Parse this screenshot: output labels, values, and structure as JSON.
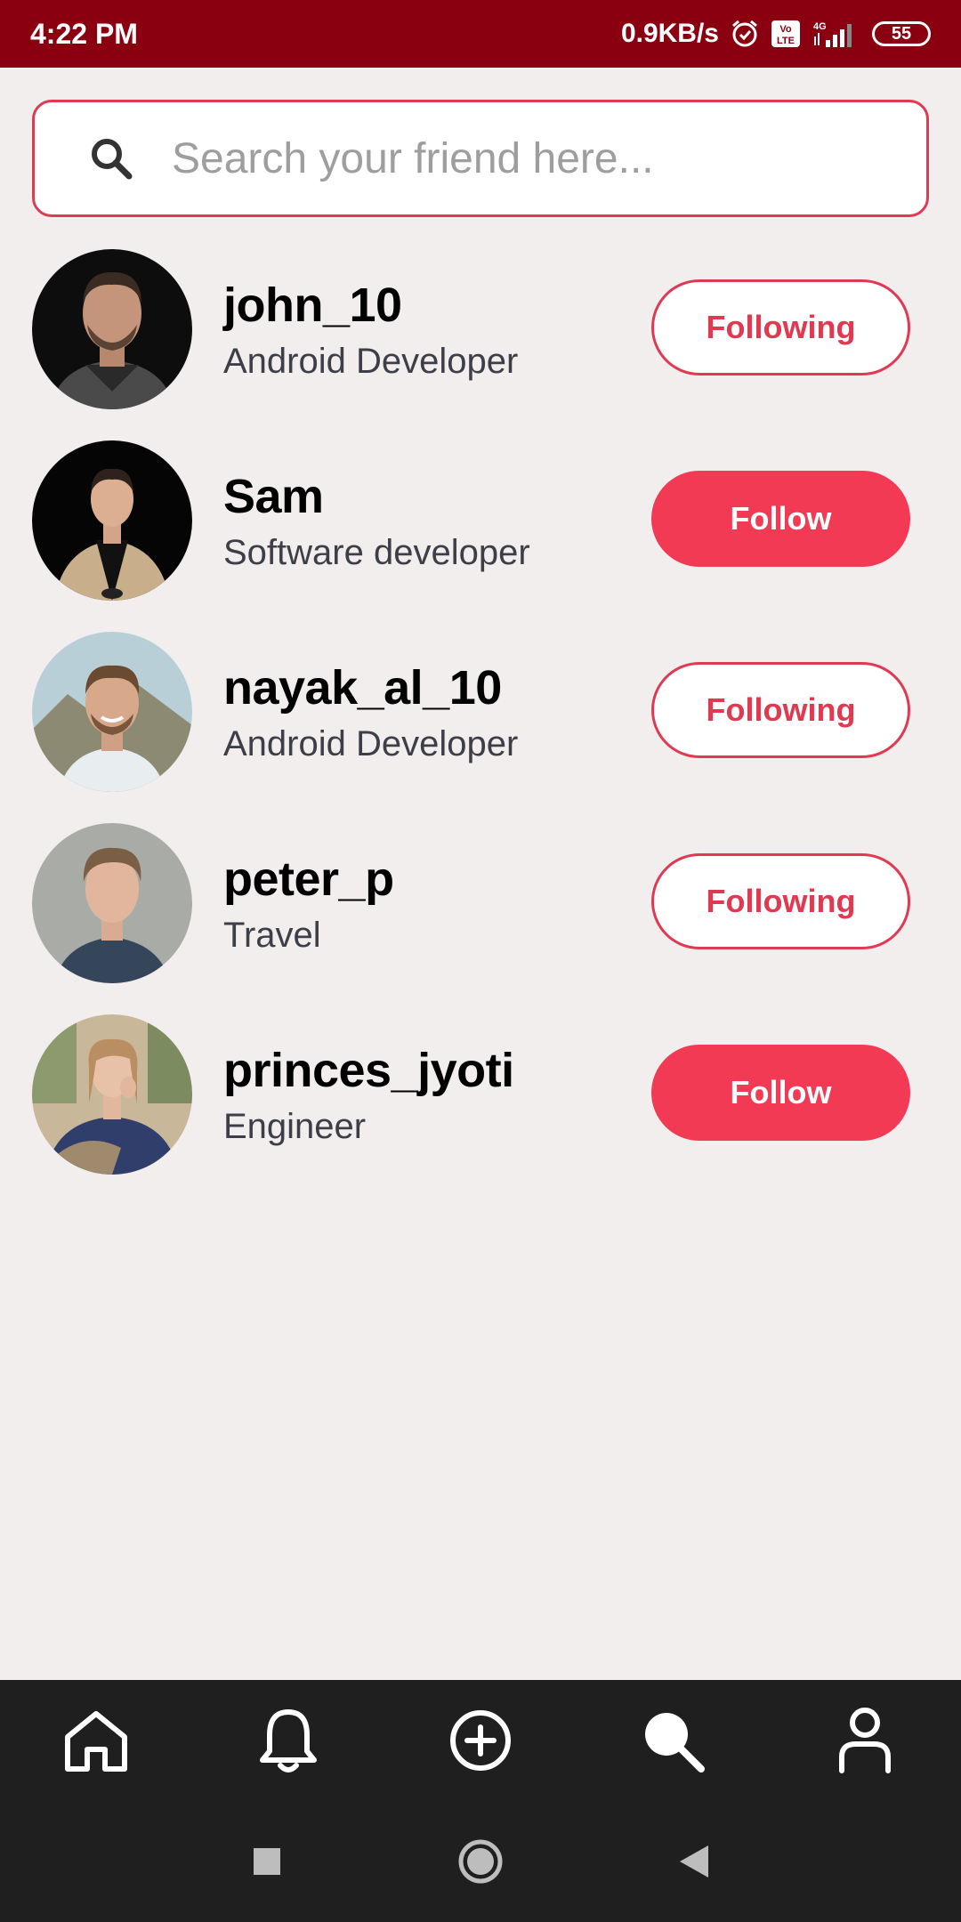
{
  "status_bar": {
    "time": "4:22 PM",
    "network_speed": "0.9KB/s",
    "volte_label": "Vo LTE",
    "network_type": "4G",
    "battery": "55"
  },
  "search": {
    "placeholder": "Search your friend here...",
    "value": ""
  },
  "users": [
    {
      "name": "john_10",
      "role": "Android Developer",
      "button": "Following",
      "state": "following"
    },
    {
      "name": "Sam",
      "role": "Software developer",
      "button": "Follow",
      "state": "follow"
    },
    {
      "name": "nayak_al_10",
      "role": "Android Developer",
      "button": "Following",
      "state": "following"
    },
    {
      "name": "peter_p",
      "role": "Travel",
      "button": "Following",
      "state": "following"
    },
    {
      "name": "princes_jyoti",
      "role": "Engineer",
      "button": "Follow",
      "state": "follow"
    }
  ],
  "bottom_nav": [
    {
      "icon": "home-icon"
    },
    {
      "icon": "bell-icon"
    },
    {
      "icon": "add-circle-icon"
    },
    {
      "icon": "search-icon",
      "active": true
    },
    {
      "icon": "profile-icon"
    }
  ],
  "colors": {
    "status_bar": "#8B0010",
    "accent": "#F23A54",
    "background": "#F2EEEE",
    "nav_background": "#1F1F1F"
  }
}
